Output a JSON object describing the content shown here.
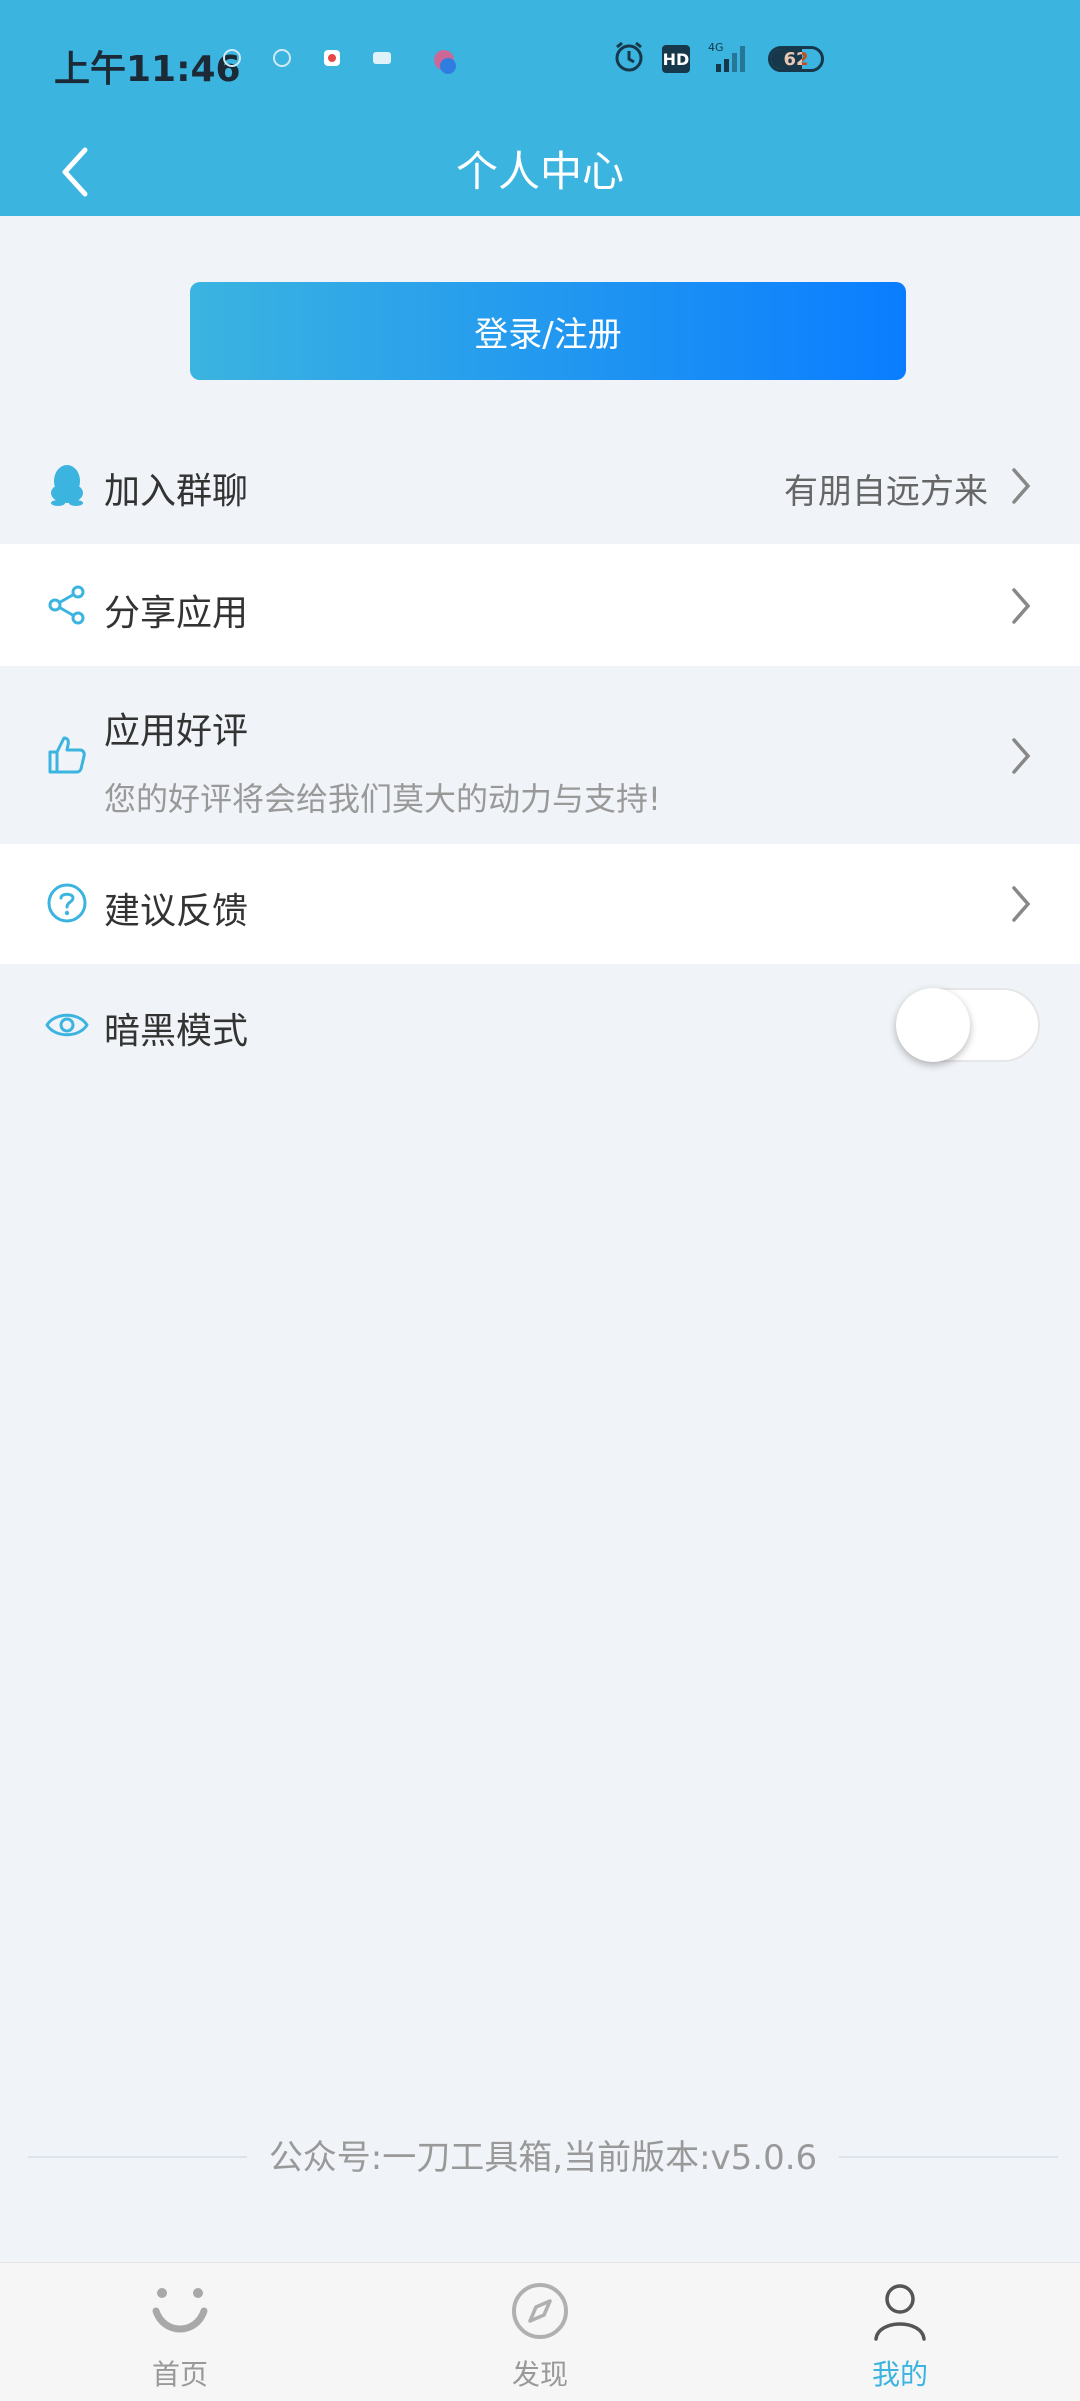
{
  "status_bar": {
    "time": "上午11:46",
    "hd": "HD",
    "network": "4G",
    "battery_level": 62,
    "battery_text": "62"
  },
  "header": {
    "title": "个人中心"
  },
  "login_button": "登录/注册",
  "menu": {
    "join_group": {
      "label": "加入群聊",
      "value": "有朋自远方来"
    },
    "share_app": {
      "label": "分享应用"
    },
    "rate_app": {
      "label": "应用好评",
      "subtitle": "您的好评将会给我们莫大的动力与支持!"
    },
    "feedback": {
      "label": "建议反馈"
    },
    "dark_mode": {
      "label": "暗黑模式",
      "enabled": false
    }
  },
  "footer": "公众号:一刀工具箱,当前版本:v5.0.6",
  "bottom_nav": {
    "home": "首页",
    "discover": "发现",
    "mine": "我的",
    "active": "mine"
  },
  "colors": {
    "accent": "#3bb4e0",
    "button_end": "#0a7dff",
    "background": "#f0f3f7"
  }
}
